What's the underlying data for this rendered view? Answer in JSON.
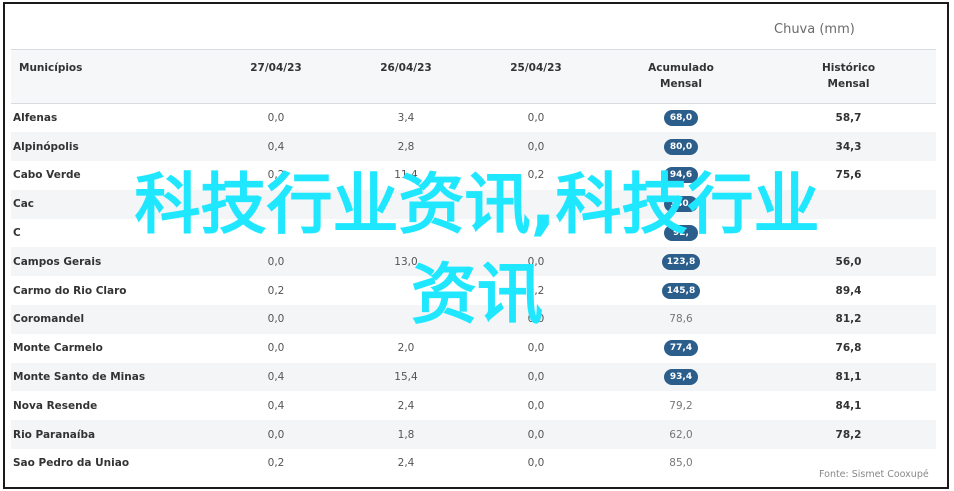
{
  "header_group": "Chuva (mm)",
  "columns": {
    "municipios": "Municípios",
    "d1": "27/04/23",
    "d2": "26/04/23",
    "d3": "25/04/23",
    "acumulado_l1": "Acumulado",
    "acumulado_l2": "Mensal",
    "historico_l1": "Histórico",
    "historico_l2": "Mensal"
  },
  "rows": [
    {
      "name": "Alfenas",
      "d1": "0,0",
      "d2": "3,4",
      "d3": "0,0",
      "acum": "68,0",
      "hist": "58,7",
      "badge": true
    },
    {
      "name": "Alpinópolis",
      "d1": "0,4",
      "d2": "2,8",
      "d3": "0,0",
      "acum": "80,0",
      "hist": "34,3",
      "badge": true
    },
    {
      "name": "Cabo Verde",
      "d1": "0,2",
      "d2": "11,4",
      "d3": "0,2",
      "acum": "94,6",
      "hist": "75,6",
      "badge": true
    },
    {
      "name": "Cac",
      "d1": "",
      "d2": "",
      "d3": "",
      "acum": "140,",
      "hist": "",
      "badge": true
    },
    {
      "name": "C",
      "d1": "",
      "d2": "",
      "d3": "",
      "acum": "92,",
      "hist": "",
      "badge": true
    },
    {
      "name": "Campos Gerais",
      "d1": "0,0",
      "d2": "13,0",
      "d3": "0,0",
      "acum": "123,8",
      "hist": "56,0",
      "badge": true
    },
    {
      "name": "Carmo do Rio Claro",
      "d1": "0,2",
      "d2": "",
      "d3": "0,2",
      "acum": "145,8",
      "hist": "89,4",
      "badge": true
    },
    {
      "name": "Coromandel",
      "d1": "0,0",
      "d2": "",
      "d3": "0,0",
      "acum": "78,6",
      "hist": "81,2",
      "badge": false
    },
    {
      "name": "Monte Carmelo",
      "d1": "0,0",
      "d2": "2,0",
      "d3": "0,0",
      "acum": "77,4",
      "hist": "76,8",
      "badge": true
    },
    {
      "name": "Monte Santo de Minas",
      "d1": "0,4",
      "d2": "15,4",
      "d3": "0,0",
      "acum": "93,4",
      "hist": "81,1",
      "badge": true
    },
    {
      "name": "Nova Resende",
      "d1": "0,4",
      "d2": "2,4",
      "d3": "0,0",
      "acum": "79,2",
      "hist": "84,1",
      "badge": false
    },
    {
      "name": "Rio Paranaíba",
      "d1": "0,0",
      "d2": "1,8",
      "d3": "0,0",
      "acum": "62,0",
      "hist": "78,2",
      "badge": false
    },
    {
      "name": "Sao Pedro da Uniao",
      "d1": "0,2",
      "d2": "2,4",
      "d3": "0,0",
      "acum": "85,0",
      "hist": "",
      "badge": false
    }
  ],
  "fonte": "Fonte: Sismet Cooxupé",
  "overlay_line1": "科技行业资讯,科技行业",
  "overlay_line2": "资讯",
  "colors": {
    "badge": "#2c5e8c",
    "overlay": "#1fe7ff"
  }
}
